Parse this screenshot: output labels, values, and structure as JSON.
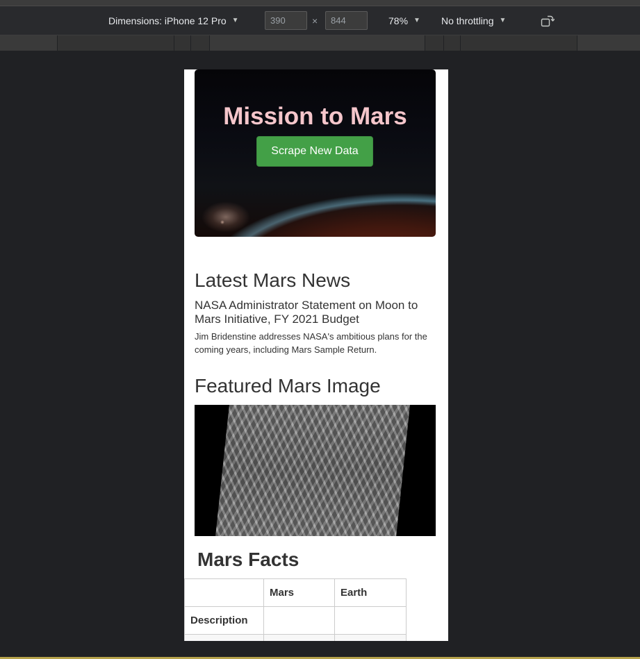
{
  "devtools": {
    "dimensions_label": "Dimensions: iPhone 12 Pro",
    "width_value": "390",
    "height_value": "844",
    "times_symbol": "×",
    "zoom_label": "78%",
    "throttling_label": "No throttling",
    "caret_glyph": "▼",
    "icons": {
      "rotate": "rotate-icon"
    }
  },
  "page": {
    "jumbotron": {
      "title": "Mission to Mars",
      "button_label": "Scrape New Data",
      "button_color": "#43a047",
      "title_color": "#f5c6cb"
    },
    "news": {
      "heading": "Latest Mars News",
      "title": "NASA Administrator Statement on Moon to Mars Initiative, FY 2021 Budget",
      "paragraph": "Jim Bridenstine addresses NASA's ambitious plans for the coming years, including Mars Sample Return."
    },
    "featured": {
      "heading": "Featured Mars Image"
    },
    "facts": {
      "heading": "Mars Facts",
      "columns": [
        "",
        "Mars",
        "Earth"
      ],
      "rows": [
        [
          "Description",
          "",
          ""
        ],
        [
          "",
          "",
          ""
        ]
      ]
    }
  }
}
